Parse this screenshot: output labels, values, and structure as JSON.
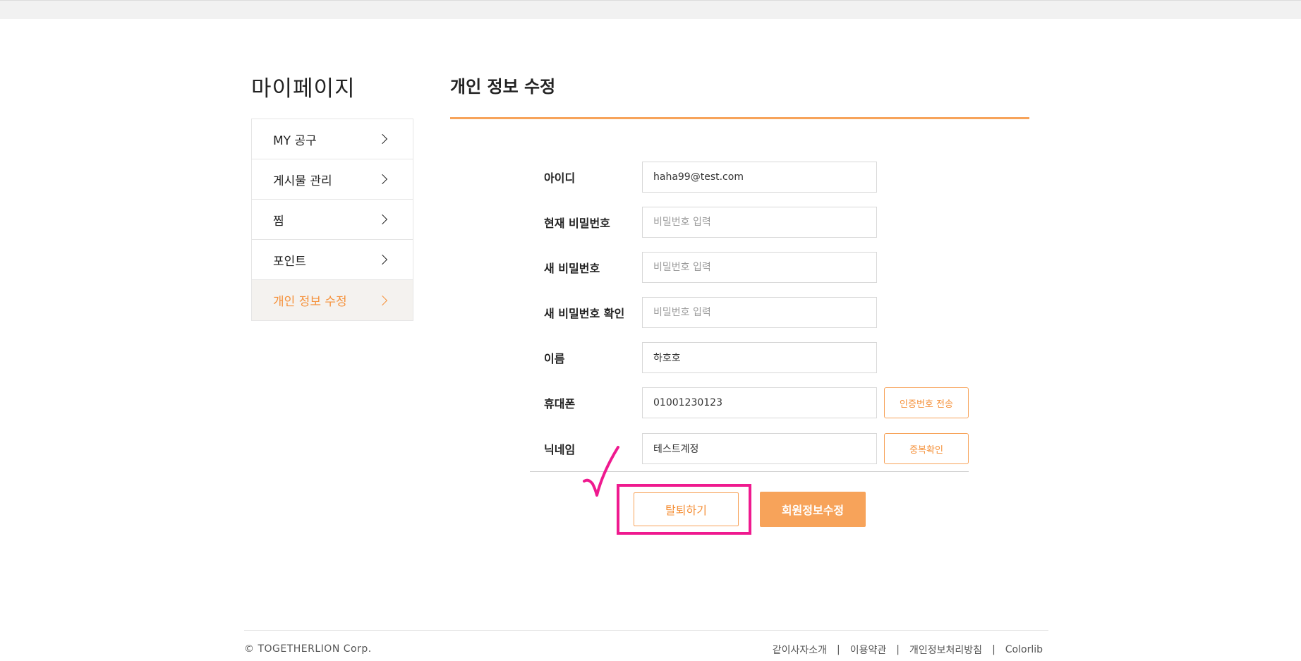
{
  "page": {
    "title": "마이페이지"
  },
  "sidebar": {
    "items": [
      {
        "label": "MY 공구",
        "active": false
      },
      {
        "label": "게시물 관리",
        "active": false
      },
      {
        "label": "찜",
        "active": false
      },
      {
        "label": "포인트",
        "active": false
      },
      {
        "label": "개인 정보 수정",
        "active": true
      }
    ]
  },
  "section": {
    "title": "개인 정보 수정"
  },
  "form": {
    "id": {
      "label": "아이디",
      "value": "haha99@test.com"
    },
    "current_password": {
      "label": "현재 비밀번호",
      "placeholder": "비밀번호 입력"
    },
    "new_password": {
      "label": "새 비밀번호",
      "placeholder": "비밀번호 입력"
    },
    "confirm_password": {
      "label": "새 비밀번호 확인",
      "placeholder": "비밀번호 입력"
    },
    "name": {
      "label": "이름",
      "value": "하호호"
    },
    "phone": {
      "label": "휴대폰",
      "value": "01001230123",
      "button": "인증번호 전송"
    },
    "nickname": {
      "label": "닉네임",
      "value": "테스트계정",
      "button": "중복확인"
    }
  },
  "actions": {
    "withdraw": "탈퇴하기",
    "update": "회원정보수정"
  },
  "footer": {
    "copyright": "© TOGETHERLION Corp.",
    "links": [
      "같이사자소개",
      "이용약관",
      "개인정보처리방침",
      "Colorlib"
    ],
    "separator": "|"
  },
  "colors": {
    "accent": "#f7a35a",
    "accent_text": "#f5913a",
    "highlight": "#ef1a8f"
  }
}
